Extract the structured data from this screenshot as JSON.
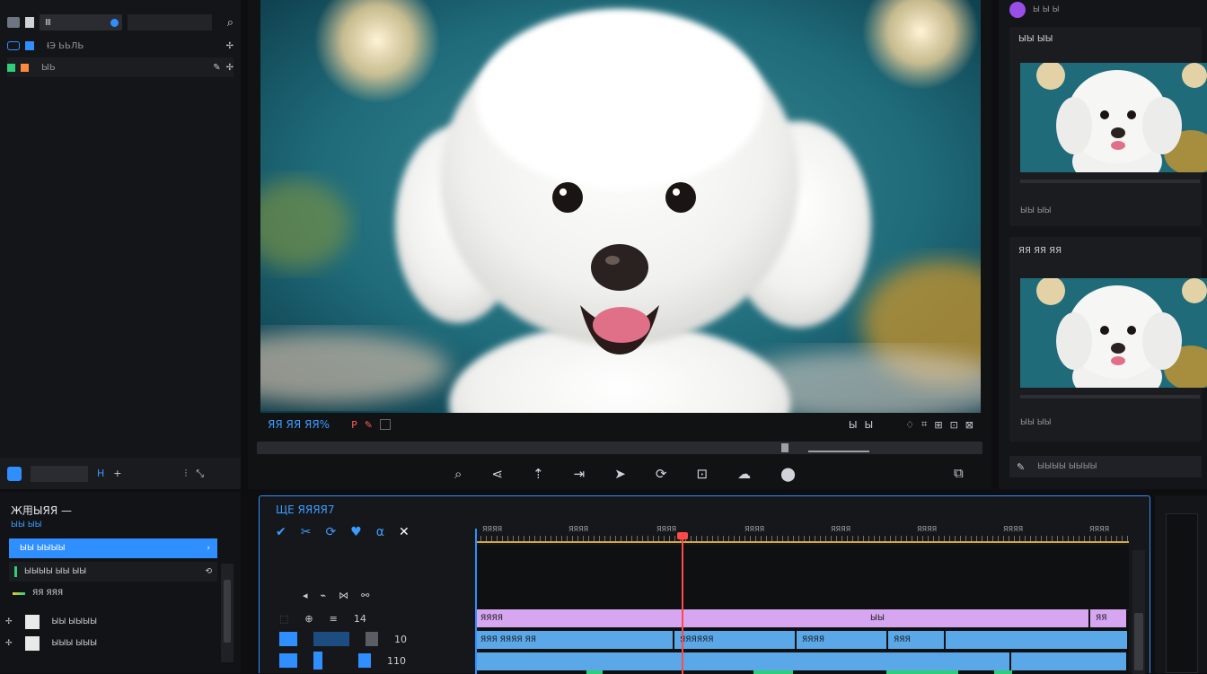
{
  "left_panel": {
    "rows": [
      {
        "label": "Ⅲ",
        "value": ""
      },
      {
        "label": "ƗЭ ЬЬЛЬ",
        "value": ""
      },
      {
        "label": "ЫЬ",
        "value": ""
      }
    ],
    "bottom_label": "H"
  },
  "viewer": {
    "timecode": "ЯЯ ЯЯ ЯЯ%",
    "marker_label": "P",
    "controls_right": [
      "Ы",
      "Ы"
    ]
  },
  "right_panel": {
    "top_label": "Ы Ы Ы",
    "card1": {
      "title": "ЫЫ ЫЫ",
      "info": "ЫЫ ЫЫ"
    },
    "card2": {
      "title": "ЯЯ ЯЯ ЯЯ",
      "info": "ЫЫ ЫЫ"
    },
    "footer_text": "ЫЫЫЫ ЫЫЫЫ"
  },
  "bottom_left": {
    "title": "Ж用ЫЯЯ —",
    "subtitle": "ЫЫ ЫЫ",
    "items": [
      {
        "label": "ЫЫ ЫЫЫЫ",
        "selected": true
      },
      {
        "label": "ЫЫЫЫ ЫЫ ЫЫ",
        "selected": false
      },
      {
        "label": "ЯЯ ЯЯЯ",
        "selected": false
      },
      {
        "label": "ЫЫ ЫЫЫЫ",
        "selected": false
      },
      {
        "label": "ЫЫЫ ЫЫЫ",
        "selected": false
      }
    ]
  },
  "timeline": {
    "title": "ЩЕ ЯЯЯЯ7",
    "ruler": [
      "ЯЯЯЯ",
      "ЯЯЯЯ",
      "ЯЯЯЯ",
      "ЯЯЯЯ",
      "ЯЯЯЯ",
      "ЯЯЯЯ",
      "ЯЯЯЯ",
      "ЯЯЯЯ"
    ],
    "track_labels": [
      "14",
      "10",
      "110"
    ],
    "clips": {
      "purple": [
        "ЯЯЯЯ",
        "ЫЫ",
        "ЯЯ"
      ],
      "blue": [
        "ЯЯЯ ЯЯЯЯ ЯЯ",
        "ЯЯЯЯЯЯ",
        "ЯЯЯЯ",
        "ЯЯЯ"
      ]
    }
  },
  "colors": {
    "accent": "#2f8fff",
    "purple_clip": "#d6a6f0",
    "blue_clip": "#5aa8e8",
    "green_clip": "#2ecf7a",
    "playhead": "#ff4a4a"
  }
}
